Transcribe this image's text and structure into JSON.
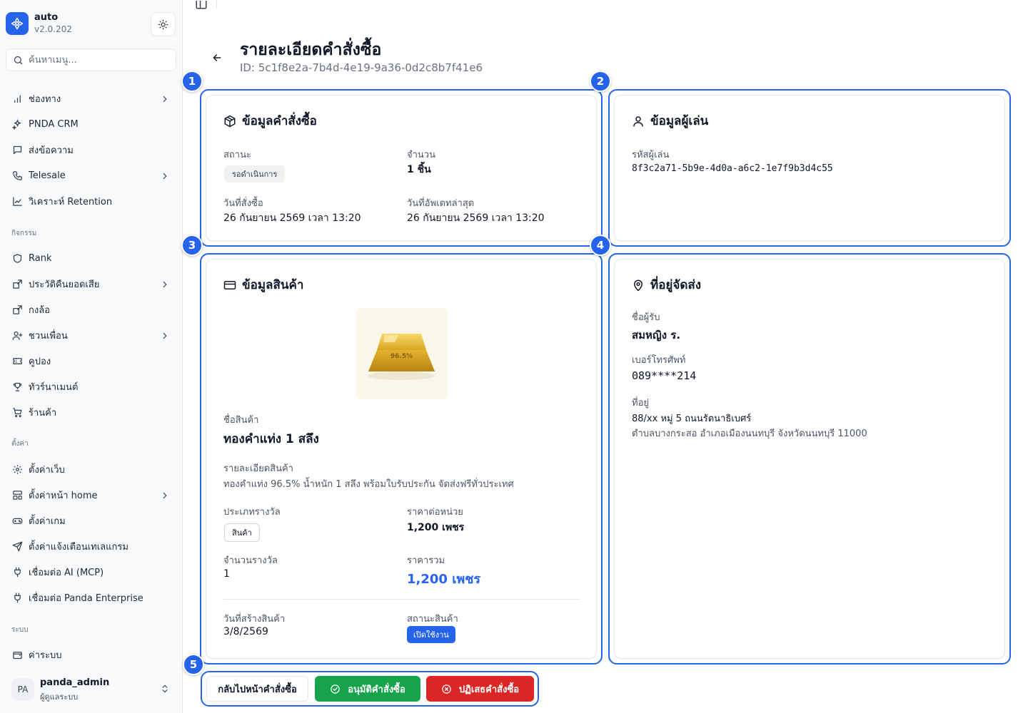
{
  "app": {
    "name": "auto",
    "version": "v2.0.202"
  },
  "sidebar": {
    "search_placeholder": "ค้นหาเมนู...",
    "items": [
      {
        "label": "ช่องทาง"
      },
      {
        "label": "PNDA CRM"
      },
      {
        "label": "ส่งข้อความ"
      },
      {
        "label": "Telesale"
      },
      {
        "label": "วิเคราะห์ Retention"
      }
    ],
    "sections": {
      "activities": "กิจกรรม",
      "settings": "ตั้งค่า",
      "system": "ระบบ"
    },
    "activity_items": [
      {
        "label": "Rank"
      },
      {
        "label": "ประวัติคืนยอดเสีย"
      },
      {
        "label": "กงล้อ"
      },
      {
        "label": "ชวนเพื่อน"
      },
      {
        "label": "คูปอง"
      },
      {
        "label": "ทัวร์นาเมนต์"
      },
      {
        "label": "ร้านค้า"
      }
    ],
    "settings_items": [
      {
        "label": "ตั้งค่าเว็บ"
      },
      {
        "label": "ตั้งค่าหน้า home"
      },
      {
        "label": "ตั้งค่าเกม"
      },
      {
        "label": "ตั้งค่าแจ้งเตือนเทเลแกรม"
      },
      {
        "label": "เชื่อมต่อ AI (MCP)"
      },
      {
        "label": "เชื่อมต่อ Panda Enterprise"
      }
    ],
    "system_items": [
      {
        "label": "ค่าระบบ"
      }
    ],
    "user": {
      "initials": "PA",
      "name": "panda_admin",
      "role": "ผู้ดูแลระบบ"
    }
  },
  "page": {
    "title": "รายละเอียดคำสั่งซื้อ",
    "id_text": "ID: 5c1f8e2a-7b4d-4e19-9a36-0d2c8b7f41e6"
  },
  "badges": [
    "1",
    "2",
    "3",
    "4",
    "5"
  ],
  "order_card": {
    "title": "ข้อมูลคำสั่งซื้อ",
    "status_label": "สถานะ",
    "status_value": "รอดำเนินการ",
    "quantity_label": "จำนวน",
    "quantity_value": "1 ชิ้น",
    "order_date_label": "วันที่สั่งซื้อ",
    "order_date_value": "26 กันยายน 2569 เวลา 13:20",
    "updated_label": "วันที่อัพเดทล่าสุด",
    "updated_value": "26 กันยายน 2569 เวลา 13:20"
  },
  "player_card": {
    "title": "ข้อมูลผู้เล่น",
    "player_id_label": "รหัสผู้เล่น",
    "player_id_value": "8f3c2a71-5b9e-4d0a-a6c2-1e7f9b3d4c55"
  },
  "product_card": {
    "title": "ข้อมูลสินค้า",
    "image_text": "96.5%",
    "name_label": "ชื่อสินค้า",
    "name_value": "ทองคำแท่ง 1 สลึง",
    "detail_label": "รายละเอียดสินค้า",
    "detail_value": "ทองคำแท่ง 96.5% น้ำหนัก 1 สลึง พร้อมใบรับประกัน จัดส่งฟรีทั่วประเทศ",
    "reward_type_label": "ประเภทรางวัล",
    "reward_type_value": "สินค้า",
    "unit_price_label": "ราคาต่อหน่วย",
    "unit_price_value": "1,200 เพชร",
    "reward_qty_label": "จำนวนรางวัล",
    "reward_qty_value": "1",
    "total_label": "ราคารวม",
    "total_value": "1,200 เพชร",
    "created_label": "วันที่สร้างสินค้า",
    "created_value": "3/8/2569",
    "product_status_label": "สถานะสินค้า",
    "product_status_value": "เปิดใช้งาน"
  },
  "shipping_card": {
    "title": "ที่อยู่จัดส่ง",
    "recipient_label": "ชื่อผู้รับ",
    "recipient_value": "สมหญิง ร.",
    "phone_label": "เบอร์โทรศัพท์",
    "phone_value": "089****214",
    "address_label": "ที่อยู่",
    "address_line1": "88/xx หมู่ 5 ถนนรัตนาธิเบศร์",
    "address_line2": "ตำบลบางกระสอ อำเภอเมืองนนทบุรี จังหวัดนนทบุรี 11000"
  },
  "actions": {
    "back_label": "กลับไปหน้าคำสั่งซื้อ",
    "approve_label": "อนุมัติคำสั่งซื้อ",
    "reject_label": "ปฏิเสธคำสั่งซื้อ"
  },
  "colors": {
    "accent": "#2563eb",
    "approve": "#16a34a",
    "reject": "#dc2626",
    "total_price": "#2563eb"
  }
}
